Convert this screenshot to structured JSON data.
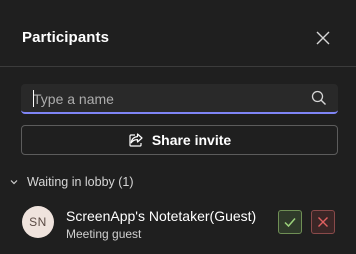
{
  "header": {
    "title": "Participants",
    "close_icon": "close-icon"
  },
  "search": {
    "placeholder": "Type a name",
    "value": "",
    "icon": "search-icon"
  },
  "share": {
    "label": "Share invite",
    "icon": "share-icon"
  },
  "lobby": {
    "label": "Waiting in lobby (1)",
    "expanded": true,
    "participants": [
      {
        "initials": "SN",
        "name": "ScreenApp's Notetaker(Guest)",
        "role": "Meeting guest"
      }
    ]
  },
  "colors": {
    "background": "#1f1f1f",
    "accent": "#7f85f5",
    "admit": "#6f8f55",
    "deny": "#d04a4a",
    "avatar_bg": "#efe3dd"
  }
}
